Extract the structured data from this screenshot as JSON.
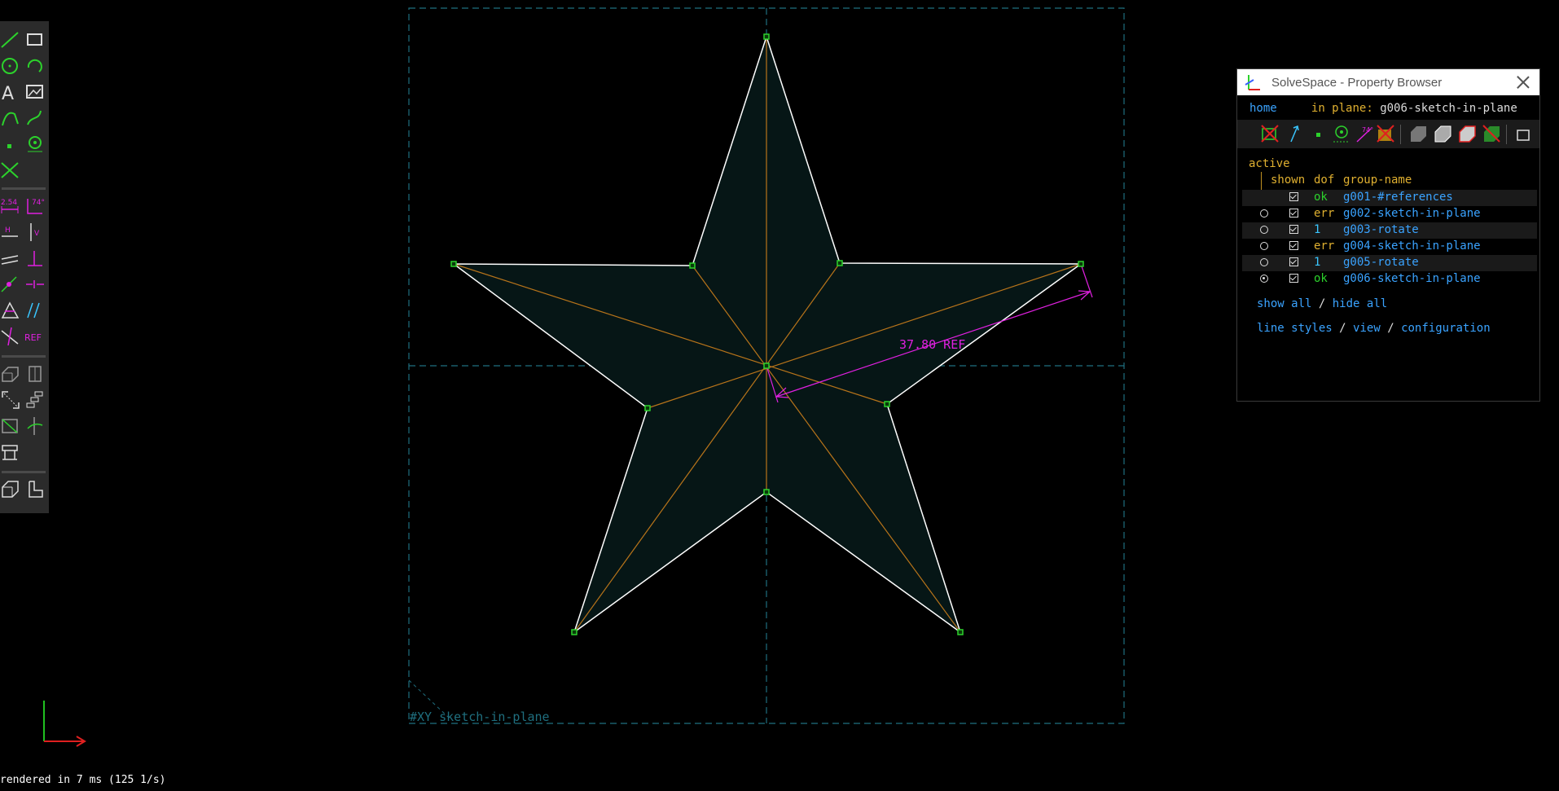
{
  "status": {
    "render_time": "rendered in 7 ms (125 1/s)"
  },
  "canvas": {
    "workplane_label": "#XY  sketch-in-plane",
    "dimension_label": "37.80 REF"
  },
  "toolbar": {
    "icons": [
      "line-icon",
      "rectangle-icon",
      "circle-icon",
      "arc-icon",
      "text-icon",
      "image-icon",
      "tangent-arc-icon",
      "bezier-icon",
      "point-icon",
      "workplane-icon",
      "split-icon",
      "distance-dim-icon",
      "angle-dim-icon",
      "horizontal-icon",
      "vertical-icon",
      "parallel-icon",
      "perpendicular-icon",
      "point-on-line-icon",
      "symmetric-icon",
      "equal-icon",
      "same-orientation-icon",
      "other-angle-icon",
      "reference-icon",
      "extrude-icon",
      "lathe-icon",
      "step-translate-icon",
      "step-rotate-icon",
      "helix-icon",
      "revolve-icon",
      "sketch-plane-icon",
      "assembly-icon",
      "nearest-ortho-icon",
      "nearest-iso-icon"
    ],
    "ref_label": "REF",
    "dim_label": "2.54",
    "angle_label": "74°"
  },
  "property_browser": {
    "title": "SolveSpace - Property Browser",
    "nav": {
      "home": "home",
      "in_plane_label": "in plane:",
      "in_plane_value": "g006-sketch-in-plane"
    },
    "header": {
      "active": "active",
      "shown": "shown",
      "dof": "dof",
      "group_name": "group-name"
    },
    "groups": [
      {
        "shown": true,
        "dof": "ok",
        "dof_color": "#2cd22c",
        "name": "g001-#references",
        "radio": false,
        "active": false
      },
      {
        "shown": true,
        "dof": "err",
        "dof_color": "#e0b030",
        "name": "g002-sketch-in-plane",
        "radio": true,
        "active": false
      },
      {
        "shown": true,
        "dof": "1",
        "dof_color": "#3ac6ff",
        "name": "g003-rotate",
        "radio": true,
        "active": false
      },
      {
        "shown": true,
        "dof": "err",
        "dof_color": "#e0b030",
        "name": "g004-sketch-in-plane",
        "radio": true,
        "active": false
      },
      {
        "shown": true,
        "dof": "1",
        "dof_color": "#3ac6ff",
        "name": "g005-rotate",
        "radio": true,
        "active": false
      },
      {
        "shown": true,
        "dof": "ok",
        "dof_color": "#2cd22c",
        "name": "g006-sketch-in-plane",
        "radio": true,
        "active": true
      }
    ],
    "links": {
      "show_all": "show all",
      "slash": "/",
      "hide_all": "hide all",
      "line_styles": "line styles",
      "view": "view",
      "configuration": "configuration"
    },
    "icon_bar": [
      "show-workplanes-icon",
      "show-normals-icon",
      "show-points-icon",
      "show-construction-icon",
      "show-constraints-icon",
      "show-faces-icon",
      "show-shaded-icon",
      "show-edges-icon",
      "show-outline-icon",
      "show-mesh-icon",
      "show-hidden-icon"
    ]
  }
}
